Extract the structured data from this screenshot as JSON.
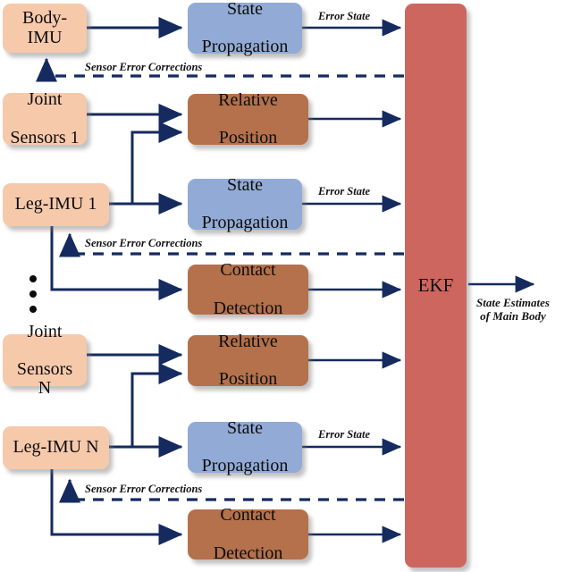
{
  "diagram": {
    "title": "Cascaded multi-IMU state estimation block diagram",
    "colors": {
      "sensor_block": "#F6C9AB",
      "propagation_block": "#92ABD6",
      "process_block": "#B4714B",
      "ekf_block": "#CE6660",
      "arrow": "#152A5E",
      "background": "#FFFFFF",
      "text": "#0D0D0D"
    }
  },
  "nodes": {
    "body_imu": {
      "label": "Body-IMU"
    },
    "state_prop_body": {
      "line1": "State",
      "line2": "Propagation"
    },
    "joint_sensors_1": {
      "line1": "Joint",
      "line2": "Sensors 1"
    },
    "relative_position_1": {
      "line1": "Relative",
      "line2": "Position"
    },
    "leg_imu_1": {
      "label": "Leg-IMU 1"
    },
    "state_prop_1": {
      "line1": "State",
      "line2": "Propagation"
    },
    "contact_detection_1": {
      "line1": "Contact",
      "line2": "Detection"
    },
    "joint_sensors_n": {
      "line1": "Joint",
      "line2": "Sensors N"
    },
    "relative_position_n": {
      "line1": "Relative",
      "line2": "Position"
    },
    "leg_imu_n": {
      "label": "Leg-IMU N"
    },
    "state_prop_n": {
      "line1": "State",
      "line2": "Propagation"
    },
    "contact_detection_n": {
      "line1": "Contact",
      "line2": "Detection"
    },
    "ekf": {
      "label": "EKF"
    }
  },
  "edge_labels": {
    "error_state_body": "Error State",
    "error_state_1": "Error State",
    "error_state_n": "Error State",
    "sensor_error_corrections_body": "Sensor Error Corrections",
    "sensor_error_corrections_1": "Sensor Error Corrections",
    "sensor_error_corrections_n": "Sensor Error Corrections",
    "output_line1": "State Estimates",
    "output_line2": "of Main Body"
  },
  "ellipsis": {
    "dot_count": 3,
    "meaning": "repeated leg modules 1 through N"
  }
}
